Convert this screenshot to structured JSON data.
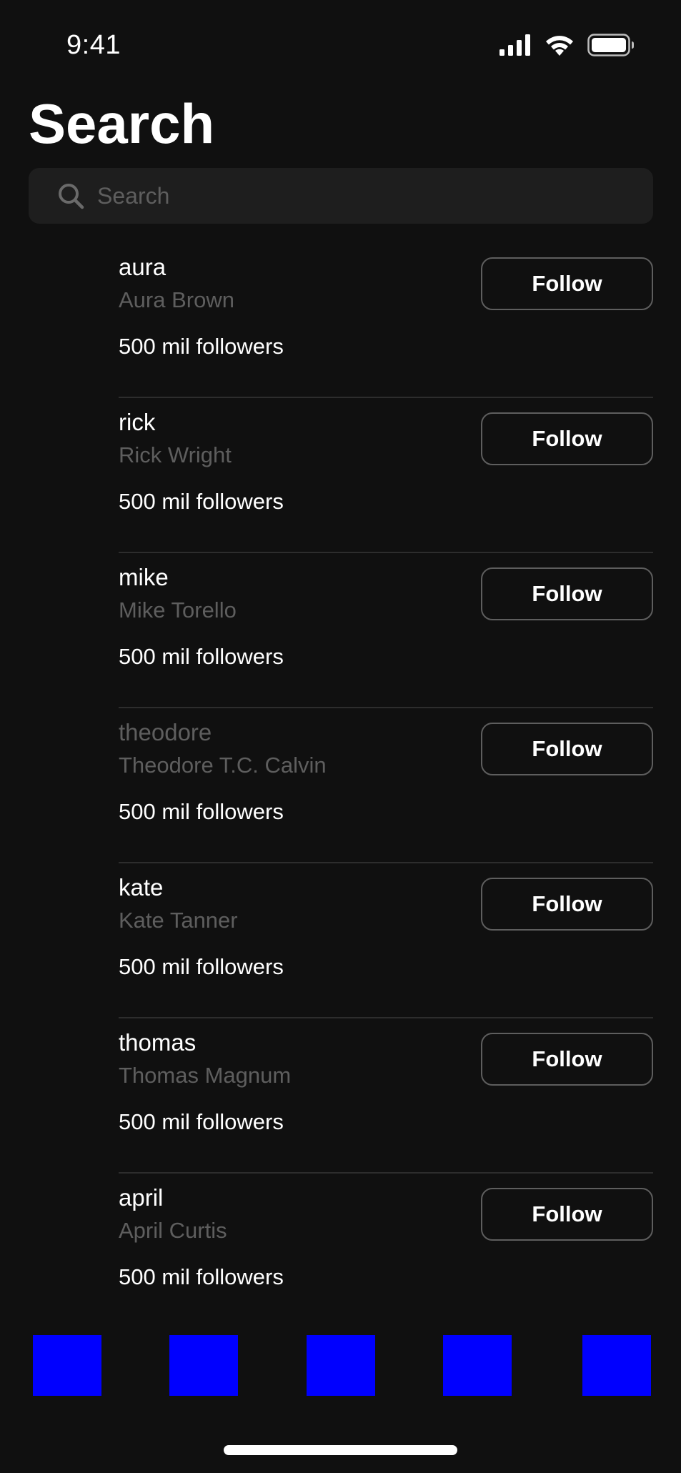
{
  "status_bar": {
    "time": "9:41",
    "icons": [
      "cellular-signal-icon",
      "wifi-icon",
      "battery-icon"
    ]
  },
  "page": {
    "title": "Search"
  },
  "search": {
    "placeholder": "Search",
    "value": "",
    "icon": "search-icon"
  },
  "results": [
    {
      "username": "aura",
      "full_name": "Aura Brown",
      "followers": "500 mil followers",
      "button_label": "Follow"
    },
    {
      "username": "rick",
      "full_name": "Rick Wright",
      "followers": "500 mil followers",
      "button_label": "Follow"
    },
    {
      "username": "mike",
      "full_name": "Mike Torello",
      "followers": "500 mil followers",
      "button_label": "Follow"
    },
    {
      "username": "theodore",
      "full_name": "Theodore T.C. Calvin",
      "followers": "500 mil followers",
      "button_label": "Follow"
    },
    {
      "username": "kate",
      "full_name": "Kate Tanner",
      "followers": "500 mil followers",
      "button_label": "Follow"
    },
    {
      "username": "thomas",
      "full_name": "Thomas Magnum",
      "followers": "500 mil followers",
      "button_label": "Follow"
    },
    {
      "username": "april",
      "full_name": "April Curtis",
      "followers": "500 mil followers",
      "button_label": "Follow"
    }
  ],
  "tab_bar": {
    "items": [
      "tab-1",
      "tab-2",
      "tab-3",
      "tab-4",
      "tab-5"
    ],
    "placeholder_color": "#0000ff"
  },
  "colors": {
    "background": "#101010",
    "search_field": "#1e1e1e",
    "secondary_text": "#5e5e5e",
    "divider": "#2d2d2d",
    "primary_text": "#ffffff"
  }
}
